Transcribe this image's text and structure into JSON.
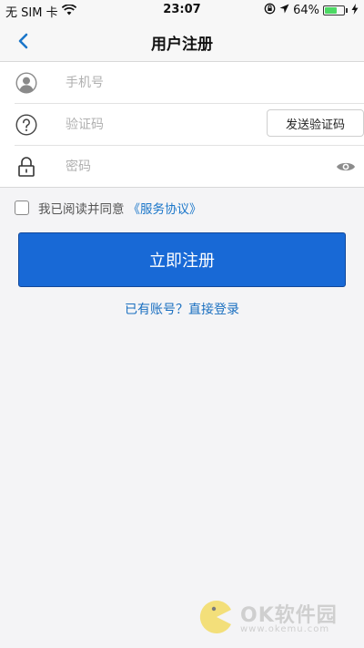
{
  "status_bar": {
    "carrier": "无 SIM 卡",
    "time": "23:07",
    "battery_percent": "64%",
    "battery_level": 0.64,
    "icons": [
      "wifi-icon",
      "orientation-lock-icon",
      "location-icon",
      "battery-icon",
      "charging-icon"
    ]
  },
  "nav": {
    "title": "用户注册",
    "back_icon": "chevron-left-icon"
  },
  "form": {
    "phone": {
      "placeholder": "手机号",
      "value": "",
      "icon": "user-icon"
    },
    "code": {
      "placeholder": "验证码",
      "value": "",
      "icon": "question-icon",
      "send_button": "发送验证码"
    },
    "password": {
      "placeholder": "密码",
      "value": "",
      "icon": "lock-icon",
      "toggle_icon": "eye-icon"
    }
  },
  "agreement": {
    "text": "我已阅读并同意",
    "link": "《服务协议》",
    "checked": false
  },
  "register_button": "立即注册",
  "login_link": "已有账号？直接登录",
  "watermark": {
    "brand": "OK软件园",
    "url": "www.okemu.com"
  },
  "colors": {
    "primary": "#1869d6",
    "link": "#1a76c9",
    "background": "#f4f4f6"
  }
}
